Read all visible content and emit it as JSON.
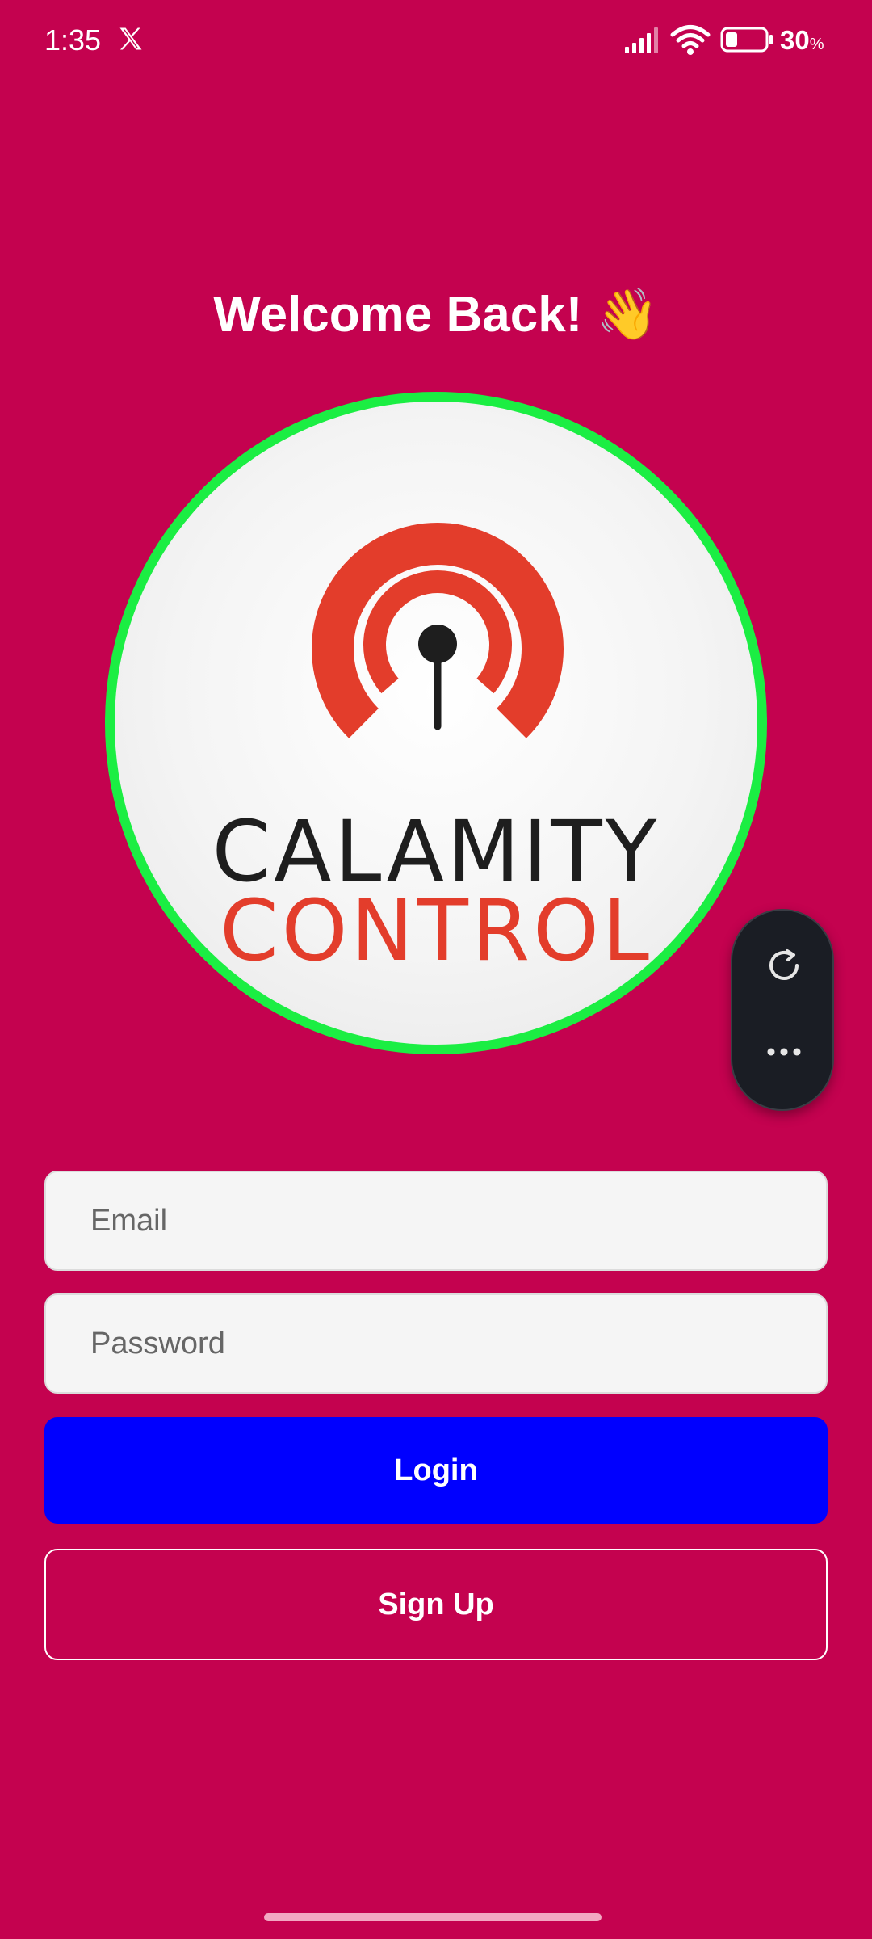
{
  "status_bar": {
    "time": "1:35",
    "battery_percent": "30",
    "battery_percent_sign": "%",
    "battery_level": 0.3,
    "icons": [
      "x-icon",
      "signal-icon",
      "wifi-icon",
      "battery-icon"
    ]
  },
  "header": {
    "title": "Welcome Back! 👋"
  },
  "logo": {
    "line1": "CALAMITY",
    "line2": "CONTROL",
    "colors": {
      "ring": "#1BEE43",
      "arc": "#E33D2B",
      "dark": "#1E1E1E"
    }
  },
  "floating_menu": {
    "icons": [
      "refresh-icon",
      "more-icon"
    ]
  },
  "form": {
    "email_placeholder": "Email",
    "password_placeholder": "Password",
    "login_label": "Login",
    "signup_label": "Sign Up"
  },
  "colors": {
    "background": "#C4024F",
    "login_button": "#0000FF",
    "input_background": "#F5F5F5"
  }
}
